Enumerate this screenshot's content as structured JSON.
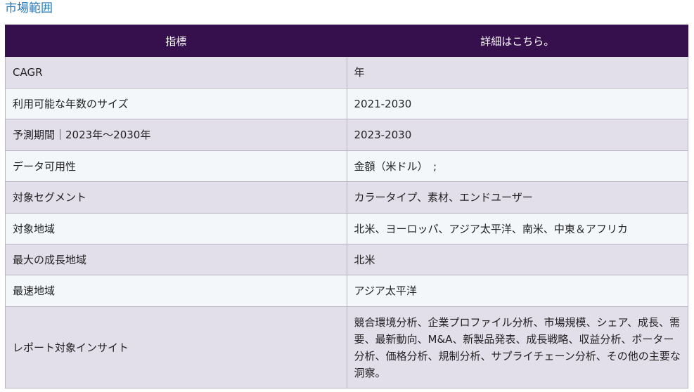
{
  "section_title": "市場範囲",
  "table": {
    "headers": [
      "指標",
      "詳細はこちら。"
    ],
    "rows": [
      [
        "CAGR",
        "年"
      ],
      [
        "利用可能な年数のサイズ",
        "2021-2030"
      ],
      [
        "予測期間｜2023年～2030年",
        "2023-2030"
      ],
      [
        "データ可用性",
        "金額（米ドル）　;"
      ],
      [
        "対象セグメント",
        "カラータイプ、素材、エンドユーザー"
      ],
      [
        "対象地域",
        "北米、ヨーロッパ、アジア太平洋、南米、中東＆アフリカ"
      ],
      [
        "最大の成長地域",
        "北米"
      ],
      [
        "最速地域",
        "アジア太平洋"
      ],
      [
        "レポート対象インサイト",
        "競合環境分析、企業プロファイル分析、市場規模、シェア、成長、需要、最新動向、M&A、新製品発表、成長戦略、収益分析、ポーター分析、価格分析、規制分析、サプライチェーン分析、その他の主要な洞察。"
      ]
    ]
  }
}
